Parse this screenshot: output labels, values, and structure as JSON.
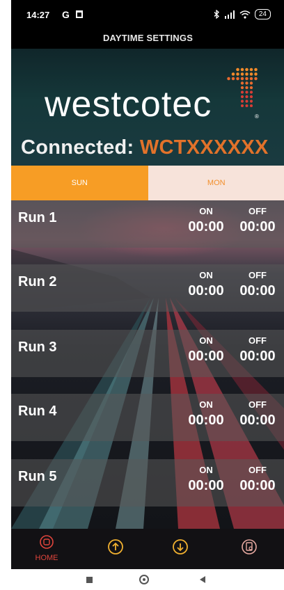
{
  "status_bar": {
    "time": "14:27",
    "g_icon": "G",
    "battery": "24",
    "icons": [
      "trash-icon",
      "bluetooth-icon",
      "signal-icon",
      "wifi-icon",
      "battery-icon"
    ]
  },
  "screen_title": "DAYTIME SETTINGS",
  "header": {
    "logo_text": "westcotec",
    "connected_label": "Connected:",
    "device_id": "WCTXXXXXX"
  },
  "tabs": [
    {
      "label": "SUN",
      "active": true
    },
    {
      "label": "MON",
      "active": false
    }
  ],
  "runs": [
    {
      "label": "Run 1",
      "on_header": "ON",
      "off_header": "OFF",
      "on_time": "00:00",
      "off_time": "00:00"
    },
    {
      "label": "Run 2",
      "on_header": "ON",
      "off_header": "OFF",
      "on_time": "00:00",
      "off_time": "00:00"
    },
    {
      "label": "Run 3",
      "on_header": "ON",
      "off_header": "OFF",
      "on_time": "00:00",
      "off_time": "00:00"
    },
    {
      "label": "Run 4",
      "on_header": "ON",
      "off_header": "OFF",
      "on_time": "00:00",
      "off_time": "00:00"
    },
    {
      "label": "Run 5",
      "on_header": "ON",
      "off_header": "OFF",
      "on_time": "00:00",
      "off_time": "00:00"
    }
  ],
  "bottom_nav": [
    {
      "label": "HOME",
      "icon": "home-icon"
    },
    {
      "label": "",
      "icon": "upload-icon"
    },
    {
      "label": "",
      "icon": "download-icon"
    },
    {
      "label": "",
      "icon": "device-settings-icon"
    }
  ],
  "colors": {
    "accent_orange": "#f79d25",
    "device_orange": "#e2722a",
    "nav_red": "#e0453c",
    "tab_inactive_bg": "#f7e3da"
  }
}
